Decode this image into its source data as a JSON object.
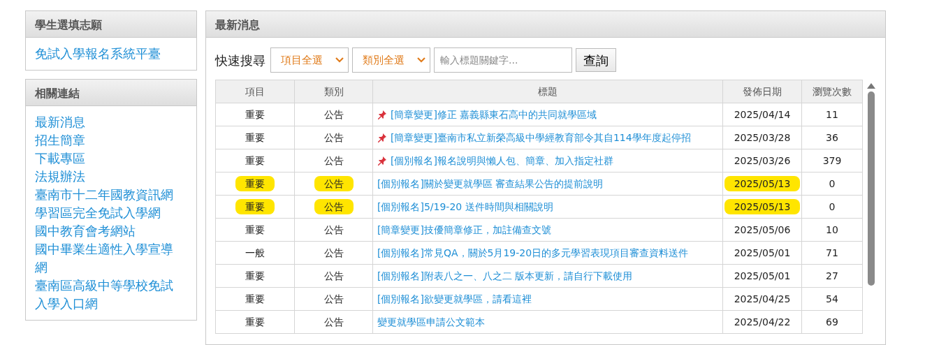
{
  "sidebar": [
    {
      "title": "學生選填志願",
      "links": [
        "免試入學報名系統平臺"
      ]
    },
    {
      "title": "相關連結",
      "links": [
        "最新消息",
        "招生簡章",
        "下載專區",
        "法規辦法",
        "臺南市十二年國教資訊網",
        "學習區完全免試入學網",
        "國中教育會考網站",
        "國中畢業生適性入學宣導網",
        "臺南區高級中等學校免試入學入口網"
      ]
    }
  ],
  "news": {
    "title": "最新消息",
    "search": {
      "label": "快速搜尋",
      "filters": [
        "項目全選",
        "類別全選"
      ],
      "keyword": {
        "placeholder": "輸入標題關鍵字..."
      },
      "button": "查詢"
    },
    "table": {
      "columns": [
        "項目",
        "類別",
        "標題",
        "發佈日期",
        "瀏覽次數"
      ],
      "rows": [
        {
          "item": "重要",
          "category": "公告",
          "title": "[簡章變更]修正 嘉義縣東石高中的共同就學區域",
          "date": "2025/04/14",
          "views": "11",
          "pinned": true,
          "highlighted": false
        },
        {
          "item": "重要",
          "category": "公告",
          "title": "[簡章變更]臺南市私立新榮高級中學經教育部令其自114學年度起停招",
          "date": "2025/03/28",
          "views": "36",
          "pinned": true,
          "highlighted": false
        },
        {
          "item": "重要",
          "category": "公告",
          "title": "[個別報名]報名說明與懶人包、簡章、加入指定社群",
          "date": "2025/03/26",
          "views": "379",
          "pinned": true,
          "highlighted": false
        },
        {
          "item": "重要",
          "category": "公告",
          "title": "[個別報名]關於變更就學區 審查結果公告的提前說明",
          "date": "2025/05/13",
          "views": "0",
          "pinned": false,
          "highlighted": true
        },
        {
          "item": "重要",
          "category": "公告",
          "title": "[個別報名]5/19-20 送件時間與相關說明",
          "date": "2025/05/13",
          "views": "0",
          "pinned": false,
          "highlighted": true
        },
        {
          "item": "重要",
          "category": "公告",
          "title": "[簡章變更]技優簡章修正，加註備查文號",
          "date": "2025/05/06",
          "views": "10",
          "pinned": false,
          "highlighted": false
        },
        {
          "item": "一般",
          "category": "公告",
          "title": "[個別報名]常見QA，關於5月19-20日的多元學習表現項目審查資料送件",
          "date": "2025/05/01",
          "views": "71",
          "pinned": false,
          "highlighted": false
        },
        {
          "item": "重要",
          "category": "公告",
          "title": "[個別報名]附表八之一、八之二 版本更新，請自行下載使用",
          "date": "2025/05/01",
          "views": "27",
          "pinned": false,
          "highlighted": false
        },
        {
          "item": "重要",
          "category": "公告",
          "title": "[個別報名]欲變更就學區，請看這裡",
          "date": "2025/04/25",
          "views": "54",
          "pinned": false,
          "highlighted": false
        },
        {
          "item": "重要",
          "category": "公告",
          "title": "變更就學區申請公文範本",
          "date": "2025/04/22",
          "views": "69",
          "pinned": false,
          "highlighted": false
        }
      ]
    }
  }
}
